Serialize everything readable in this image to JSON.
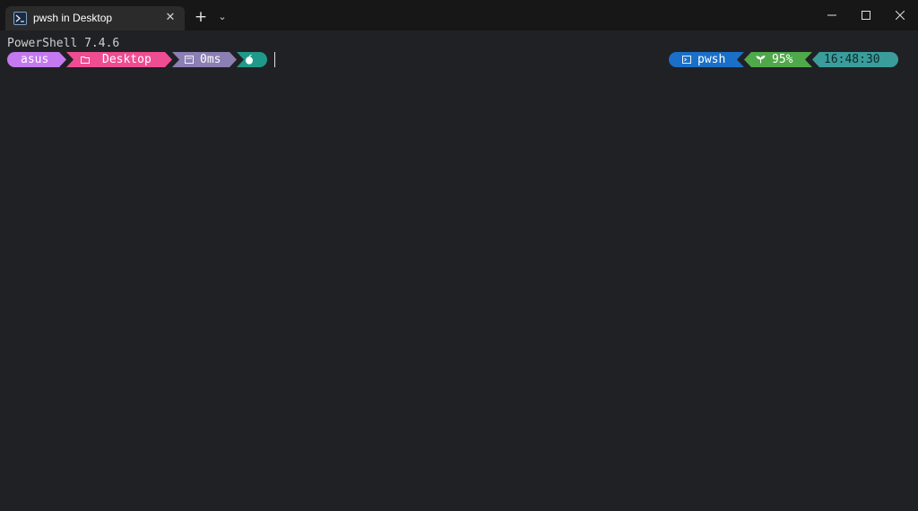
{
  "window": {
    "tab_title": "pwsh in Desktop",
    "tab_icon": "powershell-icon",
    "close_glyph": "✕",
    "newtab_glyph": "+",
    "dropdown_glyph": "⌄"
  },
  "terminal": {
    "header_line": "PowerShell 7.4.6",
    "left_prompt": {
      "user": "asus",
      "folder_icon": "folder-icon",
      "path": "Desktop",
      "exec_icon": "timer-icon",
      "duration": "0ms",
      "status_icon": "apple-icon"
    },
    "right_prompt": {
      "shell_icon": "terminal-icon",
      "shell": "pwsh",
      "battery_icon": "leaf-icon",
      "battery": "95%",
      "time": "16:48:30"
    }
  },
  "colors": {
    "background": "#202124",
    "user_segment": "#c479f0",
    "path_segment": "#ef4d92",
    "duration_segment": "#8b7fb3",
    "status_segment": "#1f9a8a",
    "shell_segment": "#1a6fc8",
    "battery_segment": "#4fa84a",
    "time_segment": "#3a9d9b"
  }
}
